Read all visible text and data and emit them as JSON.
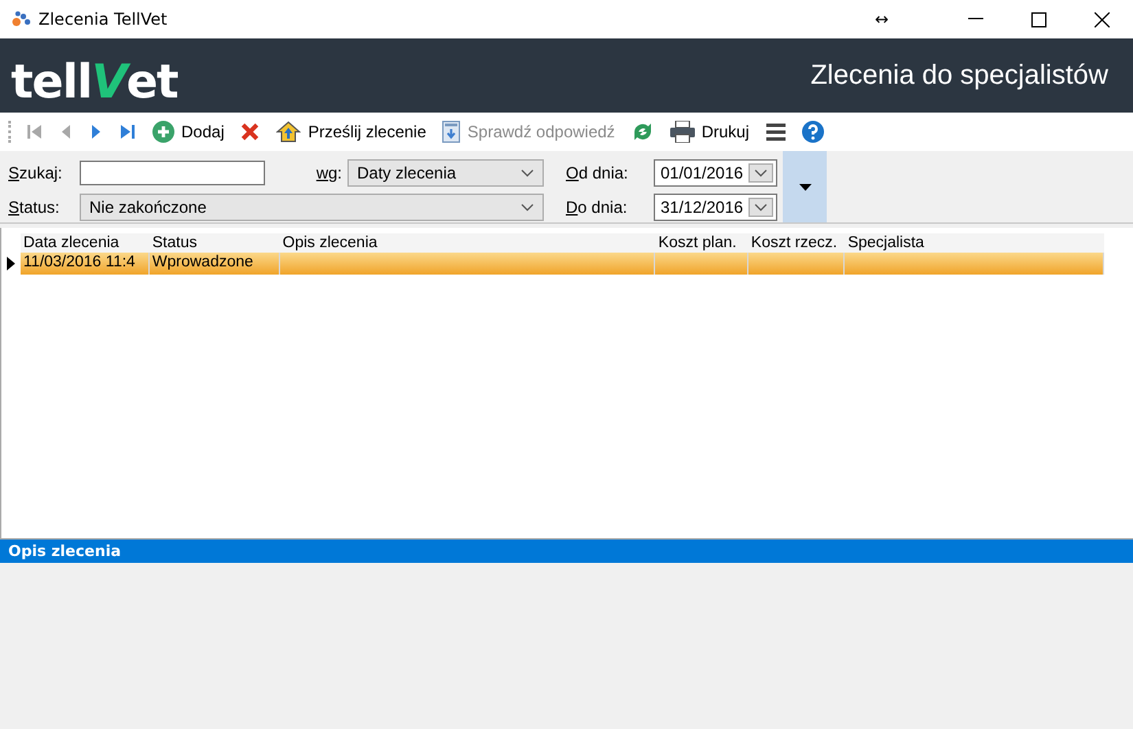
{
  "window": {
    "title": "Zlecenia TellVet",
    "resize_glyph": "↔"
  },
  "header": {
    "logo_parts": [
      "tell",
      "V",
      "et"
    ],
    "title": "Zlecenia do specjalistów"
  },
  "toolbar": [
    {
      "kind": "first",
      "disabled": true
    },
    {
      "kind": "prev",
      "disabled": true
    },
    {
      "kind": "next",
      "disabled": false
    },
    {
      "kind": "last",
      "disabled": false
    },
    {
      "kind": "add",
      "label": "Dodaj",
      "disabled": false
    },
    {
      "kind": "delete",
      "disabled": false
    },
    {
      "kind": "send",
      "label": "Prześlij zlecenie",
      "disabled": false
    },
    {
      "kind": "check",
      "label": "Sprawdź odpowiedź",
      "disabled": true
    },
    {
      "kind": "refresh",
      "disabled": false
    },
    {
      "kind": "print",
      "label": "Drukuj",
      "disabled": false
    },
    {
      "kind": "menu",
      "disabled": false
    },
    {
      "kind": "help",
      "disabled": false
    }
  ],
  "filters": {
    "search_label": "Szukaj:",
    "by_label": "wg:",
    "by_value": "Daty zlecenia",
    "status_label": "Status:",
    "status_value": "Nie zakończone",
    "from_label": "Od dnia:",
    "from_value": "01/01/2016",
    "to_label": "Do dnia:",
    "to_value": "31/12/2016"
  },
  "table": {
    "columns": [
      "Data zlecenia",
      "Status",
      "Opis zlecenia",
      "Koszt plan.",
      "Koszt rzecz.",
      "Specjalista"
    ],
    "rows": [
      {
        "selected": true,
        "cells": [
          "11/03/2016 11:4",
          "Wprowadzone",
          "",
          "",
          "",
          ""
        ]
      }
    ]
  },
  "details": {
    "title": "Opis zlecenia"
  }
}
